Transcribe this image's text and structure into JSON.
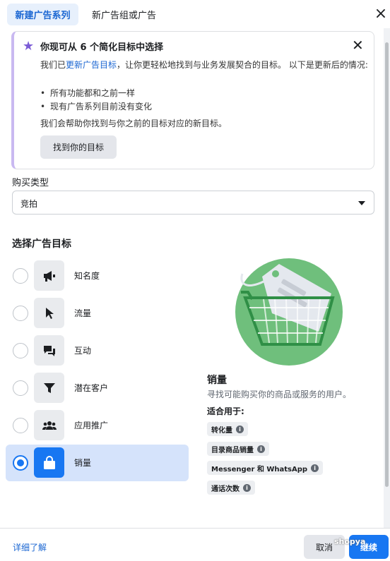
{
  "header": {
    "tab_active": "新建广告系列",
    "tab_other": "新广告组或广告",
    "close": "×"
  },
  "notice": {
    "title": "你现可从 6 个简化目标中选择",
    "p1_before": "我们已",
    "p1_link": "更新广告目标",
    "p1_after": "，让你更轻松地找到与业务发展契合的目标。 以下是更新后的情况:",
    "bullets": [
      "所有功能都和之前一样",
      "现有广告系列目前没有变化"
    ],
    "p2": "我们会帮助你找到与你之前的目标对应的新目标。",
    "button": "找到你的目标"
  },
  "buy_type": {
    "label": "购买类型",
    "value": "竞拍"
  },
  "objective_title": "选择广告目标",
  "objectives": [
    {
      "label": "知名度",
      "icon": "megaphone-icon",
      "selected": false
    },
    {
      "label": "流量",
      "icon": "cursor-icon",
      "selected": false
    },
    {
      "label": "互动",
      "icon": "chat-bubbles-icon",
      "selected": false
    },
    {
      "label": "潜在客户",
      "icon": "funnel-icon",
      "selected": false
    },
    {
      "label": "应用推广",
      "icon": "people-icon",
      "selected": false
    },
    {
      "label": "销量",
      "icon": "shopping-bag-icon",
      "selected": true
    }
  ],
  "detail": {
    "title": "销量",
    "desc": "寻找可能购买你的商品或服务的用户。",
    "fit_label": "适合用于:",
    "chips": [
      "转化量",
      "目录商品销量",
      "Messenger 和 WhatsApp",
      "通话次数"
    ]
  },
  "footer": {
    "learn_more": "详细了解",
    "cancel": "取消",
    "submit": "继续",
    "watermark": "shopya"
  },
  "colors": {
    "accent": "#1877f2",
    "selected_bg": "#d5e3fb",
    "illustration_green": "#6fbf7c"
  }
}
